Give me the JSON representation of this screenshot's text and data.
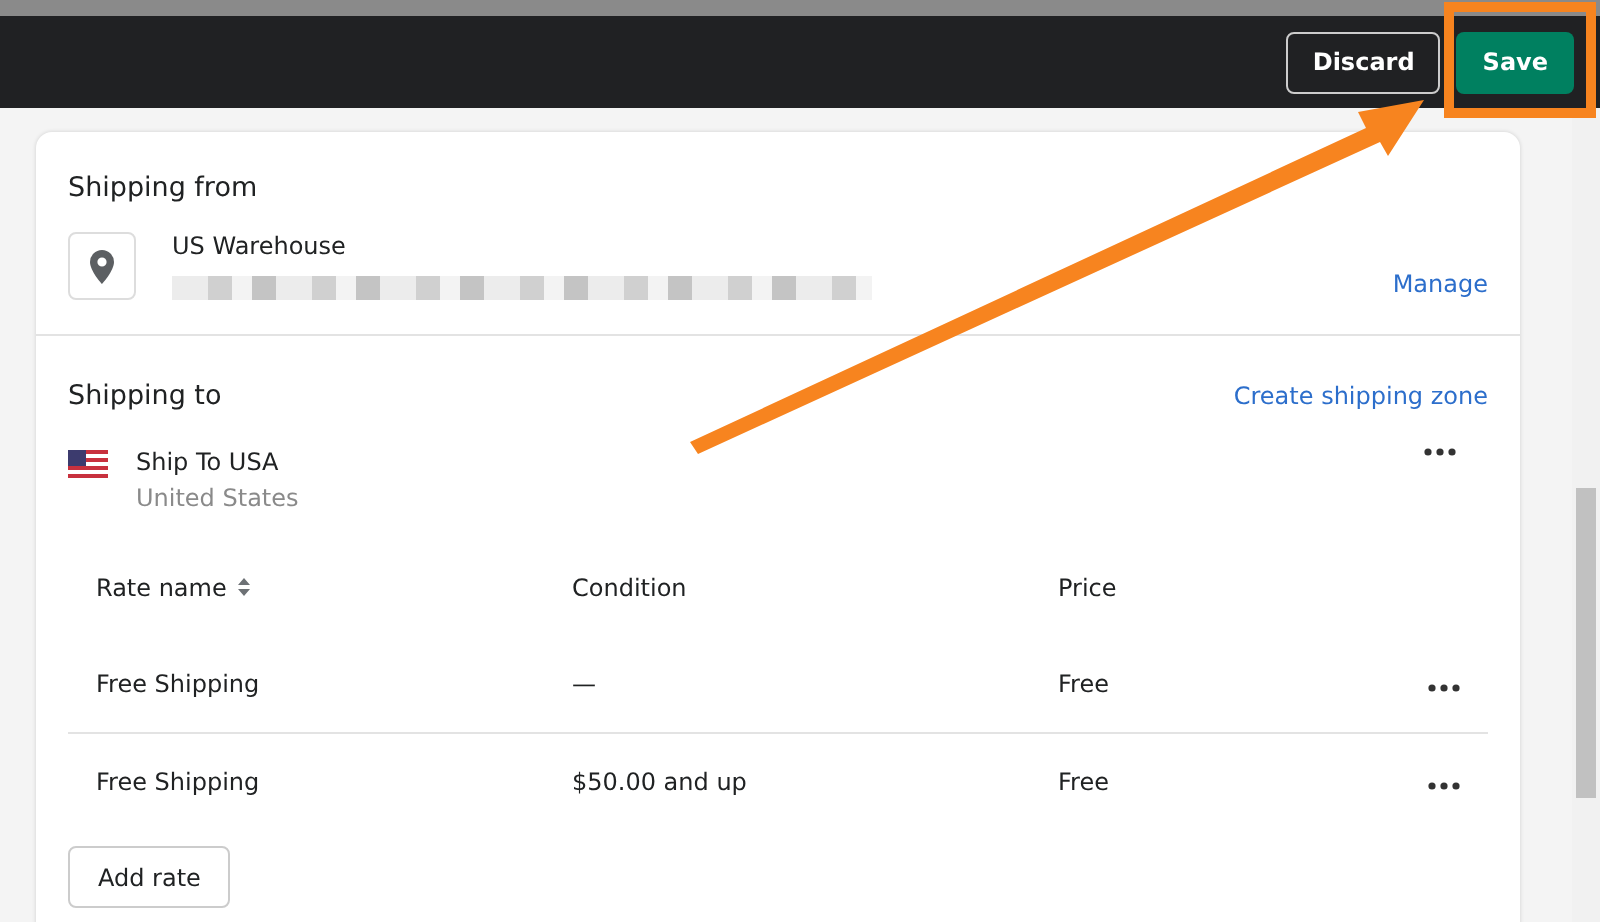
{
  "top_bar": {
    "buttons": [
      {
        "label": "Discard",
        "kind": "secondary"
      },
      {
        "label": "Save",
        "kind": "primary"
      }
    ]
  },
  "shipping_from": {
    "title": "Shipping from",
    "location_name": "US Warehouse",
    "action": "Manage"
  },
  "shipping_to": {
    "title": "Shipping to",
    "action": "Create shipping zone",
    "zone": {
      "name": "Ship To USA",
      "country": "United States"
    },
    "table": {
      "columns": [
        "Rate name",
        "Condition",
        "Price"
      ],
      "rows": [
        {
          "name": "Free Shipping",
          "condition": "—",
          "price": "Free"
        },
        {
          "name": "Free Shipping",
          "condition": "$50.00 and up",
          "price": "Free"
        }
      ]
    },
    "add_button": "Add rate"
  }
}
